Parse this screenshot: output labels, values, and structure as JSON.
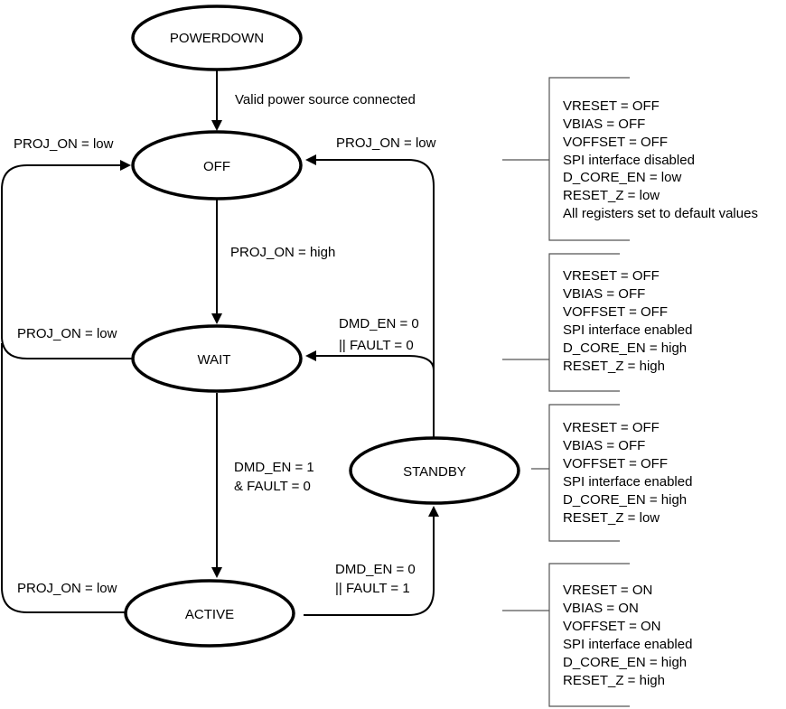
{
  "diagram": {
    "type": "state-machine",
    "nodes": [
      {
        "id": "powerdown",
        "label": "POWERDOWN"
      },
      {
        "id": "off",
        "label": "OFF"
      },
      {
        "id": "wait",
        "label": "WAIT"
      },
      {
        "id": "standby",
        "label": "STANDBY"
      },
      {
        "id": "active",
        "label": "ACTIVE"
      }
    ],
    "edges": [
      {
        "id": "powerdown-to-off",
        "from": "powerdown",
        "to": "off",
        "label": [
          "Valid power source connected"
        ]
      },
      {
        "id": "off-to-wait",
        "from": "off",
        "to": "wait",
        "label": [
          "PROJ_ON = high"
        ]
      },
      {
        "id": "wait-to-active",
        "from": "wait",
        "to": "active",
        "label": [
          "DMD_EN = 1",
          "& FAULT = 0"
        ]
      },
      {
        "id": "active-to-standby",
        "from": "active",
        "to": "standby",
        "label": [
          "DMD_EN = 0",
          "|| FAULT = 1"
        ]
      },
      {
        "id": "standby-to-wait",
        "from": "standby",
        "to": "wait",
        "label": [
          "DMD_EN = 0",
          "||  FAULT = 0"
        ]
      },
      {
        "id": "standby-to-off",
        "from": "standby",
        "to": "off",
        "label": [
          "PROJ_ON = low"
        ]
      },
      {
        "id": "wait-to-off",
        "from": "wait",
        "to": "off",
        "label": [
          "PROJ_ON = low"
        ]
      },
      {
        "id": "active-to-off",
        "from": "active",
        "to": "off",
        "label": [
          "PROJ_ON = low"
        ]
      },
      {
        "id": "left-loop-to-off",
        "from": "wait",
        "to": "off",
        "label": [
          "PROJ_ON = low"
        ]
      }
    ],
    "state_boxes": [
      {
        "state": "off",
        "lines": [
          "VRESET = OFF",
          "VBIAS = OFF",
          "VOFFSET = OFF",
          "SPI interface disabled",
          "D_CORE_EN = low",
          "RESET_Z = low",
          "All registers set to default values"
        ]
      },
      {
        "state": "wait",
        "lines": [
          "VRESET = OFF",
          "VBIAS = OFF",
          "VOFFSET = OFF",
          "SPI interface enabled",
          "D_CORE_EN = high",
          "RESET_Z = high"
        ]
      },
      {
        "state": "standby",
        "lines": [
          "VRESET = OFF",
          "VBIAS = OFF",
          "VOFFSET = OFF",
          "SPI interface enabled",
          "D_CORE_EN = high",
          "RESET_Z = low"
        ]
      },
      {
        "state": "active",
        "lines": [
          "VRESET = ON",
          "VBIAS = ON",
          "VOFFSET = ON",
          "SPI interface enabled",
          "D_CORE_EN = high",
          "RESET_Z = high"
        ]
      }
    ],
    "colors": {
      "line": "#000000",
      "box_line": "#555555",
      "background": "#ffffff"
    }
  }
}
